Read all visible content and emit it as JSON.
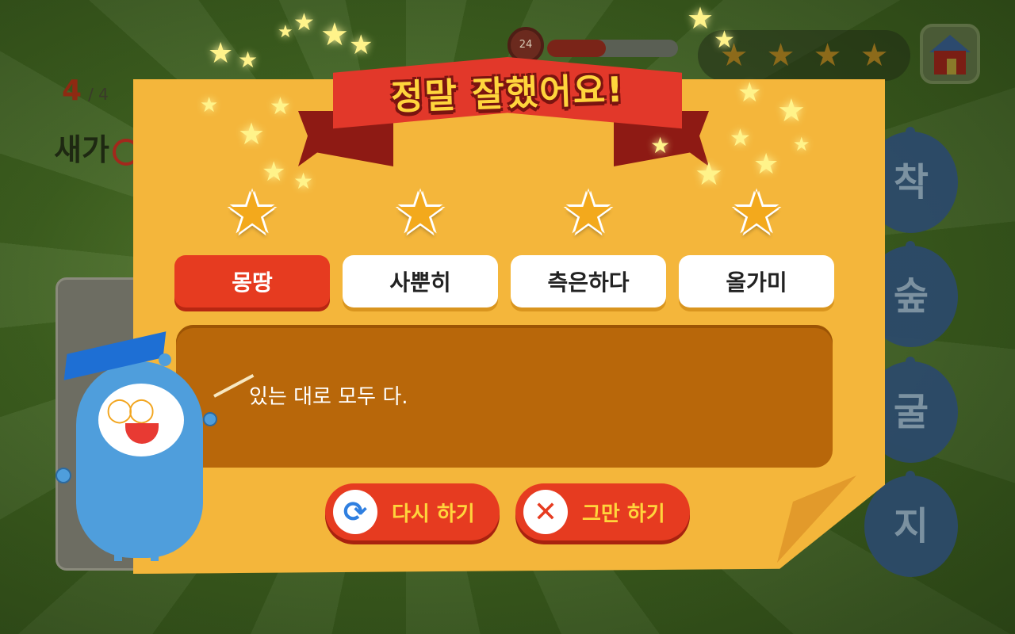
{
  "progress": {
    "current": "4",
    "total": "/ 4"
  },
  "question": {
    "text": "새가"
  },
  "timer": {
    "value": "24",
    "fill_fraction": 0.45
  },
  "score_stars": {
    "count": 4,
    "icon": "star-icon"
  },
  "home": {
    "icon": "home-icon"
  },
  "choices": [
    "착",
    "숲",
    "굴",
    "지"
  ],
  "modal": {
    "title": "정말 잘했어요!",
    "words": [
      "몽땅",
      "사뿐히",
      "측은하다",
      "올가미"
    ],
    "selected_index": 0,
    "definition": "있는 대로 모두 다.",
    "buttons": {
      "retry": {
        "label": "다시 하기",
        "icon": "refresh-icon"
      },
      "stop": {
        "label": "그만 하기",
        "icon": "close-icon"
      }
    }
  },
  "colors": {
    "panel": "#f4b63b",
    "ribbon": "#e2382a",
    "active_tab": "#e63b20",
    "definition_box": "#b8670a",
    "star": "#f3a91c",
    "button_label": "#ffd53c"
  }
}
